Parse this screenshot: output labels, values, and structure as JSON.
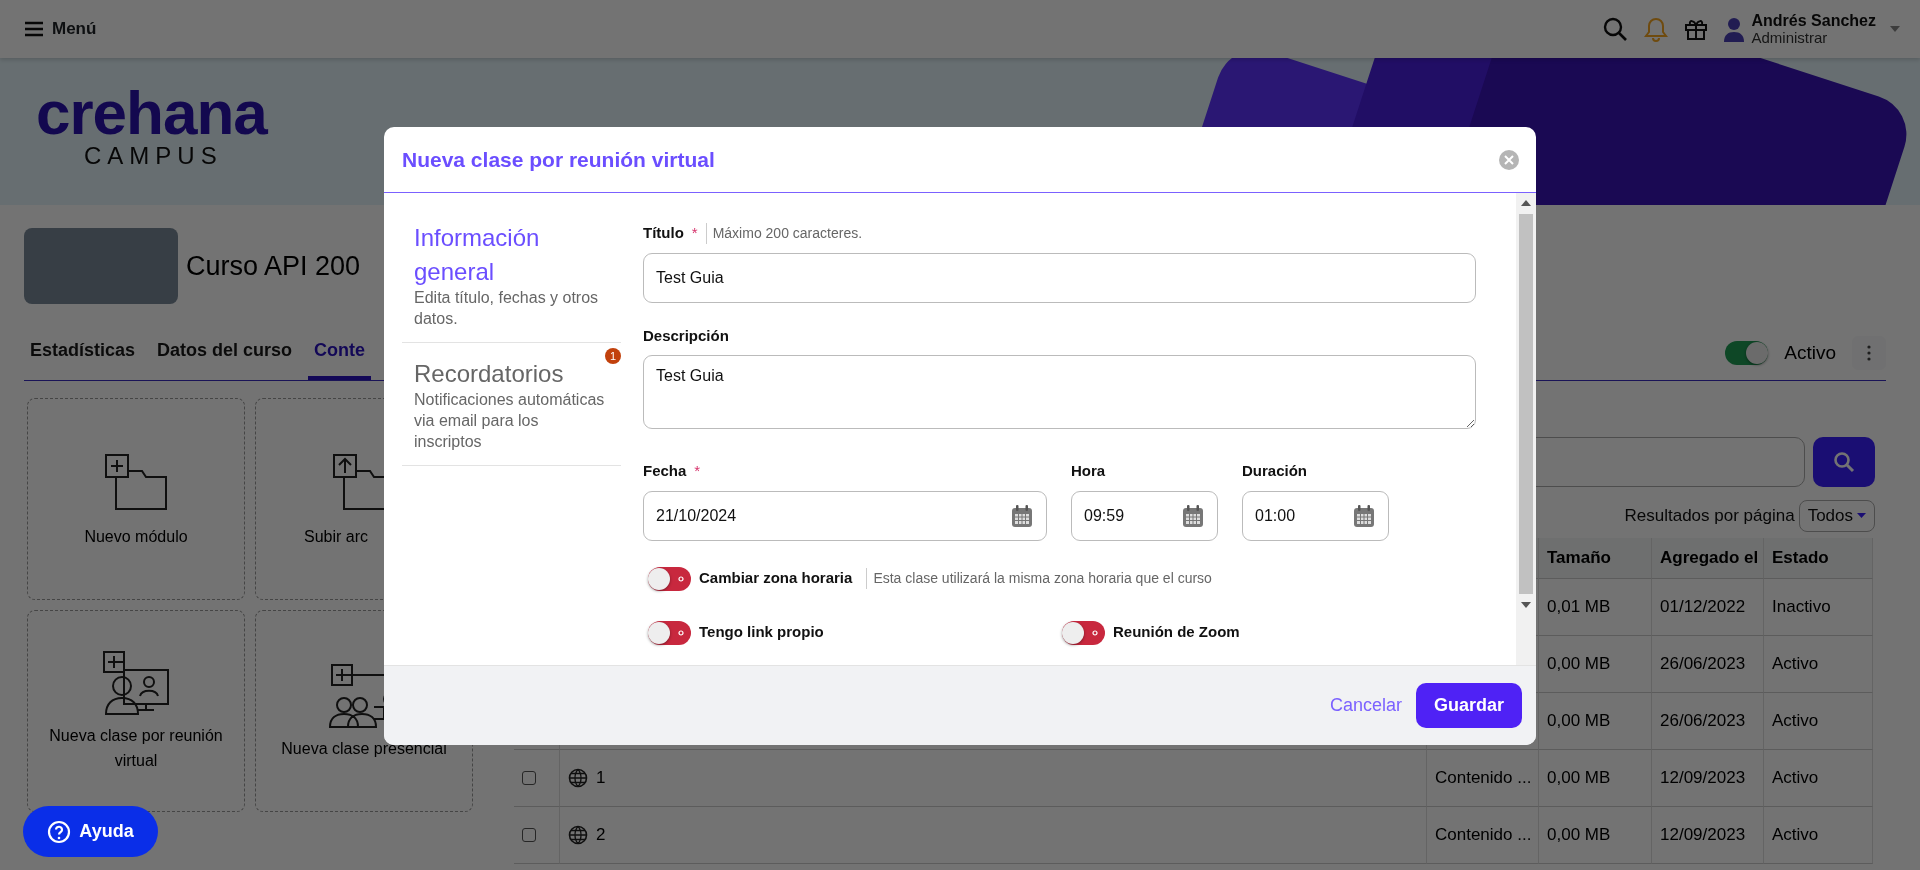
{
  "topbar": {
    "menu": "Menú",
    "user_name": "Andrés Sanchez",
    "user_role": "Administrar"
  },
  "banner": {
    "logo": "crehana",
    "logo_sub": "CAMPUS"
  },
  "course": {
    "title": "Curso API 200",
    "status": {
      "label": "Activo",
      "on": true
    },
    "tabs": [
      {
        "label": "Estadísticas",
        "selected": false
      },
      {
        "label": "Datos del curso",
        "selected": false
      },
      {
        "label": "Conte",
        "selected": true
      }
    ]
  },
  "actions": [
    {
      "label": "Nuevo módulo",
      "kind": "module"
    },
    {
      "label": "Subir arc",
      "kind": "upload"
    },
    {
      "label": "Nueva clase por reunión virtual",
      "kind": "virtual"
    },
    {
      "label": "Nueva clase presencial",
      "kind": "onsite"
    }
  ],
  "results": {
    "label": "Resultados por página",
    "value": "Todos"
  },
  "table": {
    "columns": [
      "Tamaño",
      "Agregado el",
      "Estado"
    ],
    "rows": [
      {
        "size": "0,01 MB",
        "date": "01/12/2022",
        "state": "Inactivo"
      },
      {
        "size": "0,00 MB",
        "date": "26/06/2023",
        "state": "Activo"
      },
      {
        "size": "0,00 MB",
        "date": "26/06/2023",
        "state": "Activo"
      },
      {
        "checked": false,
        "name": "1",
        "type": "Contenido ...",
        "size": "0,00 MB",
        "date": "12/09/2023",
        "state": "Activo"
      },
      {
        "checked": false,
        "name": "2",
        "type": "Contenido ...",
        "size": "0,00 MB",
        "date": "12/09/2023",
        "state": "Activo"
      }
    ]
  },
  "help_button": "Ayuda",
  "modal": {
    "title": "Nueva clase por reunión virtual",
    "sections": [
      {
        "title": "Información general",
        "description": "Edita título, fechas y otros datos.",
        "selected": true
      },
      {
        "title": "Recordatorios",
        "description": "Notificaciones automáticas via email para los inscriptos",
        "selected": false,
        "badge": "1"
      }
    ],
    "title_field": {
      "label": "Título",
      "required_mark": "*",
      "hint": "Máximo 200 caracteres.",
      "value": "Test Guia"
    },
    "description_field": {
      "label": "Descripción",
      "value": "Test Guia"
    },
    "date_fields": [
      {
        "label": "Fecha",
        "required_mark": "*",
        "value": "21/10/2024"
      },
      {
        "label": "Hora",
        "value": "09:59"
      },
      {
        "label": "Duración",
        "value": "01:00"
      }
    ],
    "switches": [
      {
        "label": "Cambiar zona horaria",
        "hint": "Esta clase utilizará la misma zona horaria que el curso",
        "on": false
      },
      {
        "label": "Tengo link propio",
        "on": false
      },
      {
        "label": "Reunión de Zoom",
        "on": false
      }
    ],
    "cancel": "Cancelar",
    "save": "Guardar"
  }
}
